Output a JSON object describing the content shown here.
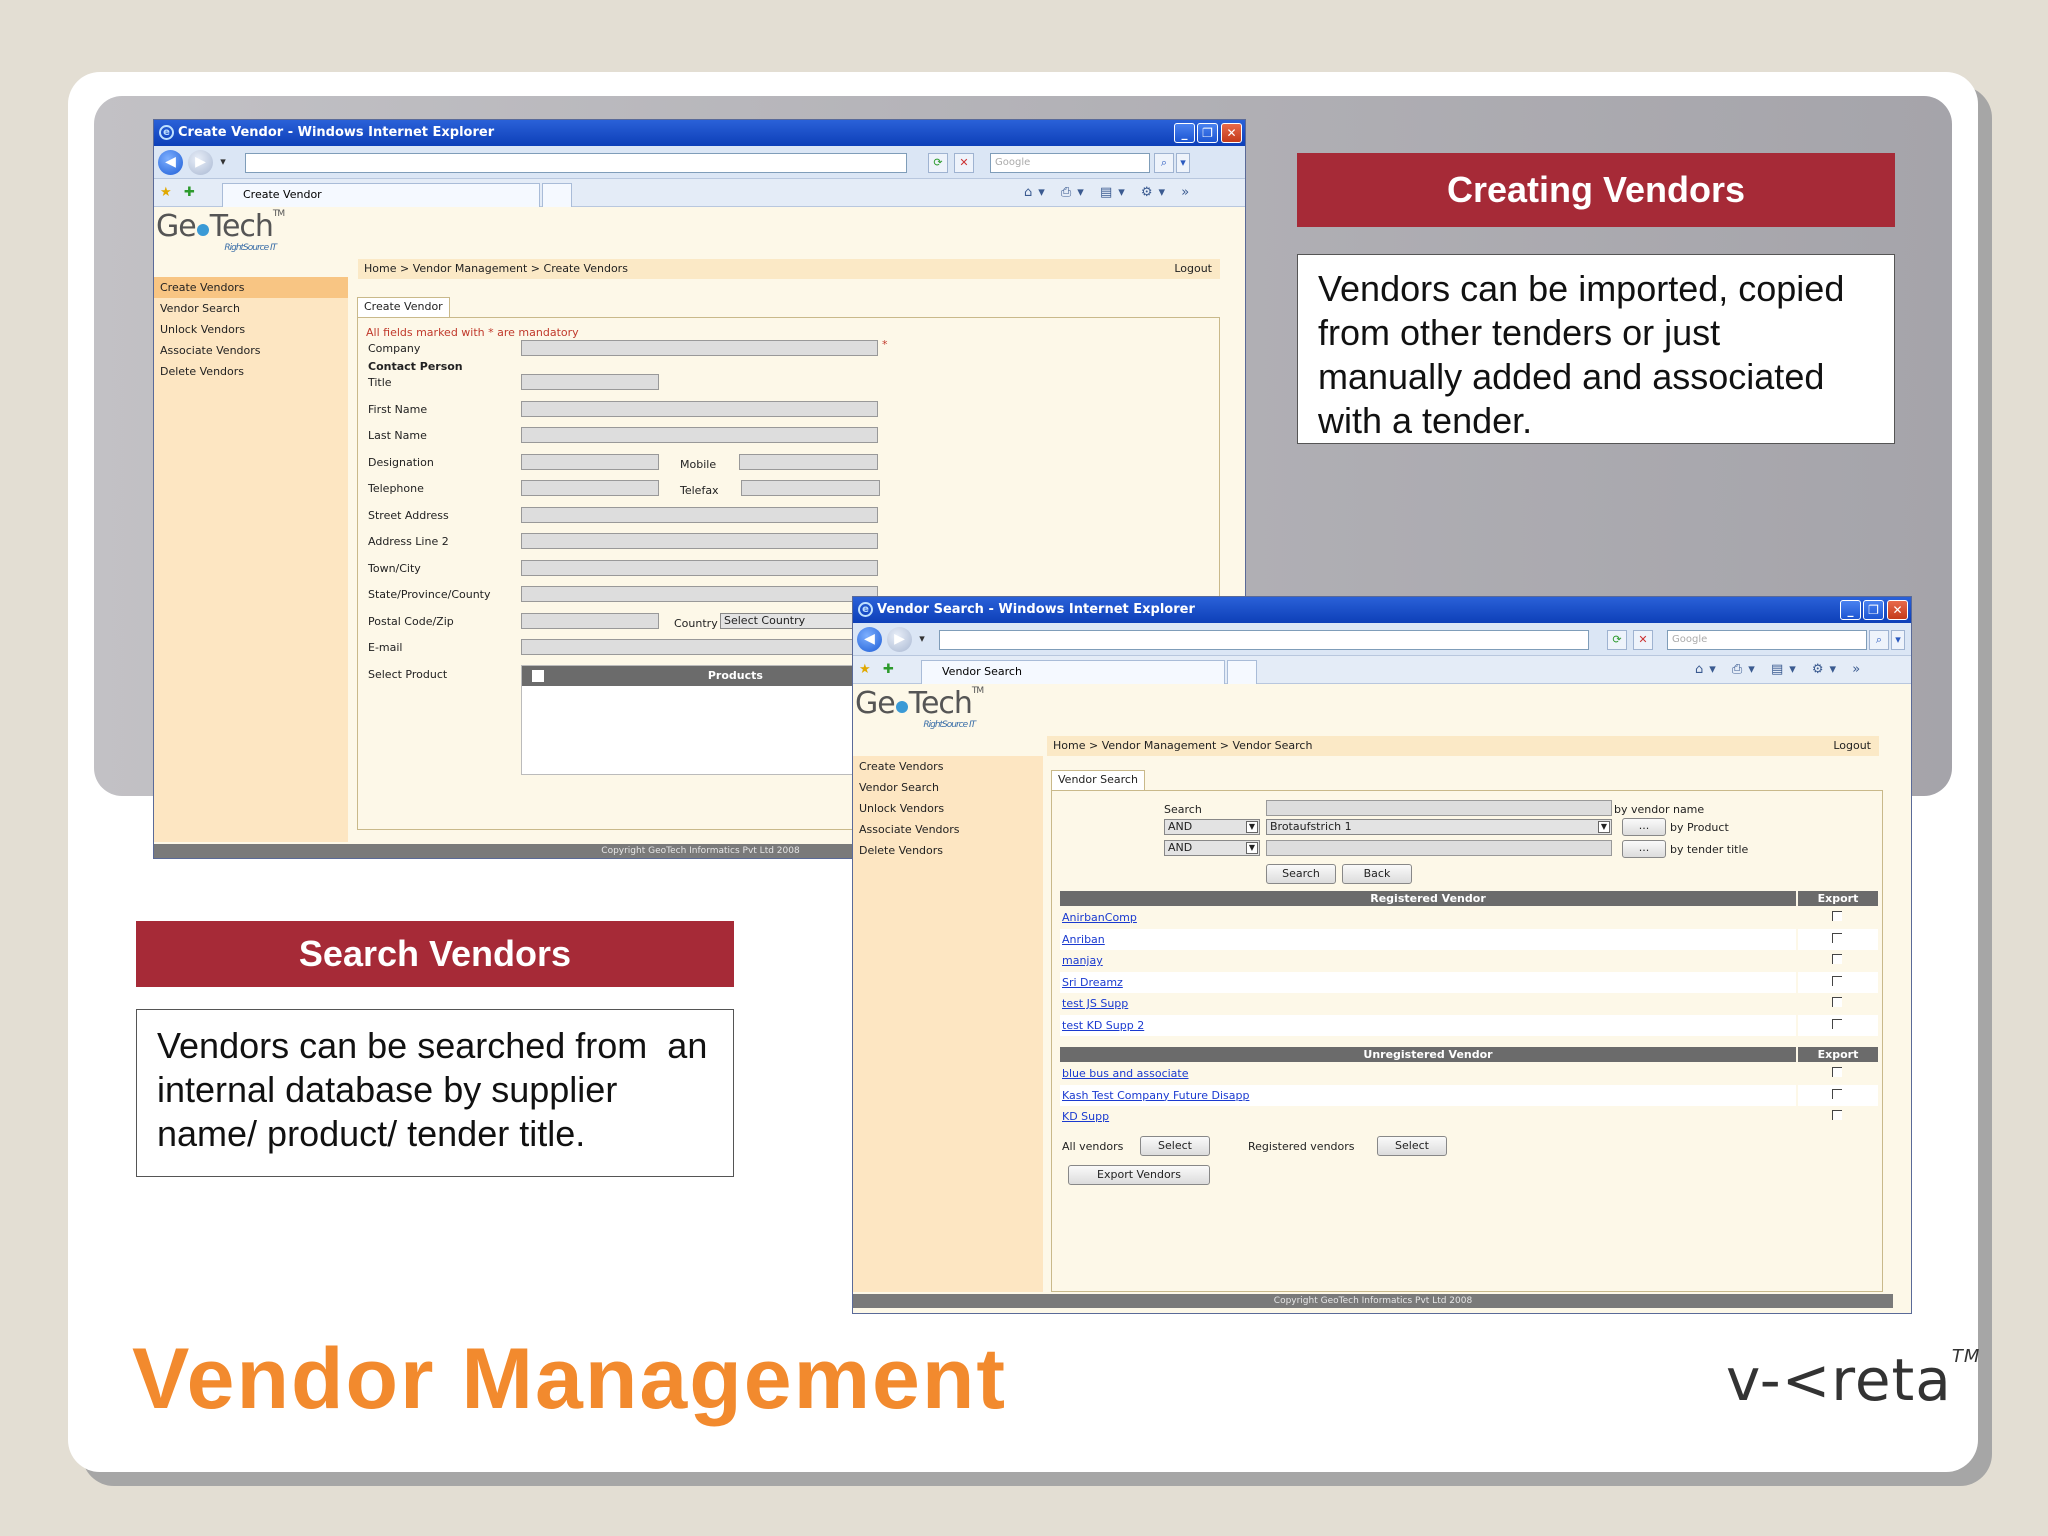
{
  "slide": {
    "title": "Vendor Management",
    "brand": "v-<reta",
    "brand_tm": "TM",
    "colors": {
      "title_orange": "#f28a2e",
      "heading_red": "#a62a37",
      "band_grey": "#b0afb4"
    }
  },
  "creating": {
    "heading": "Creating Vendors",
    "text": "Vendors can be imported, copied from other tenders or just manually added and associated with a tender."
  },
  "searching": {
    "heading": "Search Vendors",
    "text": "Vendors can be searched from  an internal database by supplier name/ product/ tender title."
  },
  "win1": {
    "title": "Create Vendor - Windows Internet Explorer",
    "search_placeholder": "Google",
    "tab_label": "Create Vendor",
    "logo": {
      "main_pre": "Ge",
      "main_post": "Tech",
      "tm": "TM",
      "sub": "RightSource IT"
    },
    "breadcrumb": "Home > Vendor Management > Create Vendors",
    "logout": "Logout",
    "sidebar": [
      "Create Vendors",
      "Vendor Search",
      "Unlock Vendors",
      "Associate Vendors",
      "Delete Vendors"
    ],
    "content_tab": "Create Vendor",
    "mandatory_note": "All fields marked with * are mandatory",
    "fields": {
      "company": "Company",
      "contact_person": "Contact Person",
      "title": "Title",
      "first_name": "First Name",
      "last_name": "Last Name",
      "designation": "Designation",
      "mobile": "Mobile",
      "telephone": "Telephone",
      "telefax": "Telefax",
      "street": "Street Address",
      "address2": "Address Line 2",
      "town": "Town/City",
      "state": "State/Province/County",
      "postal": "Postal Code/Zip",
      "country": "Country",
      "country_value": "Select Country",
      "email": "E-mail",
      "select_product": "Select Product",
      "products_header": "Products"
    },
    "copyright": "Copyright GeoTech Informatics Pvt Ltd 2008"
  },
  "win2": {
    "title": "Vendor Search - Windows Internet Explorer",
    "search_placeholder": "Google",
    "tab_label": "Vendor Search",
    "logo": {
      "main_pre": "Ge",
      "main_post": "Tech",
      "tm": "TM",
      "sub": "RightSource IT"
    },
    "breadcrumb": "Home > Vendor Management > Vendor Search",
    "logout": "Logout",
    "sidebar": [
      "Create Vendors",
      "Vendor Search",
      "Unlock Vendors",
      "Associate Vendors",
      "Delete Vendors"
    ],
    "content_tab": "Vendor Search",
    "search_label": "Search",
    "by_vendor_name": "by vendor name",
    "op1": "AND",
    "product_value": "Brotaufstrich 1",
    "by_product": "by Product",
    "op2": "AND",
    "by_tender_title": "by tender title",
    "ellipsis": "...",
    "search_btn": "Search",
    "back_btn": "Back",
    "registered_header": "Registered Vendor",
    "export_header": "Export",
    "registered": [
      "AnirbanComp",
      "Anriban",
      "manjay",
      "Sri Dreamz",
      "test JS Supp",
      "test KD Supp 2"
    ],
    "unregistered_header": "Unregistered Vendor",
    "unregistered": [
      "blue bus and associate",
      "Kash Test Company Future Disapp",
      "KD Supp"
    ],
    "all_vendors": "All vendors",
    "registered_vendors": "Registered vendors",
    "select_btn": "Select",
    "export_btn": "Export Vendors",
    "copyright": "Copyright GeoTech Informatics Pvt Ltd 2008"
  }
}
